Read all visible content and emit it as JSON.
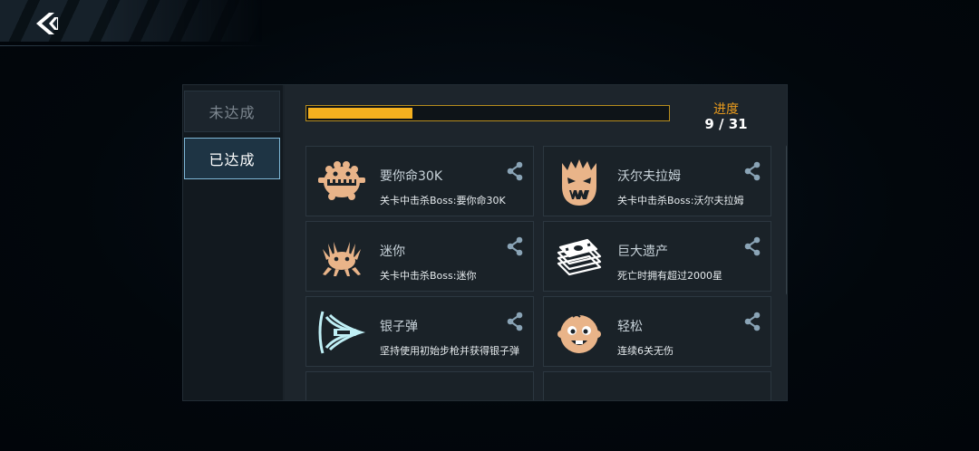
{
  "tabs": {
    "incomplete_label": "未达成",
    "completed_label": "已达成"
  },
  "progress": {
    "label": "进度",
    "count_text": "9 / 31",
    "fraction": 0.29
  },
  "achievements": [
    {
      "title": "要你命30K",
      "desc": "关卡中击杀Boss:要你命30K",
      "icon": "boss-30k-icon"
    },
    {
      "title": "沃尔夫拉姆",
      "desc": "关卡中击杀Boss:沃尔夫拉姆",
      "icon": "wolfram-boss-icon"
    },
    {
      "title": "迷你",
      "desc": "关卡中击杀Boss:迷你",
      "icon": "mini-crab-icon"
    },
    {
      "title": "巨大遗产",
      "desc": "死亡时拥有超过2000星",
      "icon": "cash-stack-icon"
    },
    {
      "title": "银子弹",
      "desc": "坚持使用初始步枪并获得银子弹",
      "icon": "silver-bullet-icon"
    },
    {
      "title": "轻松",
      "desc": "连续6关无伤",
      "icon": "smiling-face-icon"
    }
  ],
  "colors": {
    "accent_gold": "#f5b11f",
    "icon_tan": "#e9b489",
    "active_tab_border": "#7fb8d8",
    "silver_icon": "#bfeff5"
  }
}
